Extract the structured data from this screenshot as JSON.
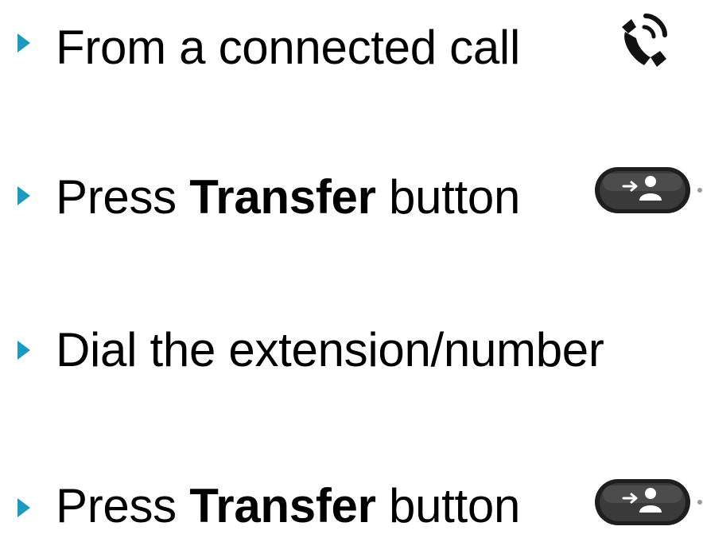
{
  "steps": [
    {
      "text": "From a connected call",
      "icon": "phone-call-icon"
    },
    {
      "text_before": "Press",
      "text_bold": "Transfer",
      "text_after": "button",
      "icon": "transfer-button-icon"
    },
    {
      "text": "Dial the extension/number"
    },
    {
      "text_before": "Press",
      "text_bold": "Transfer",
      "text_after": "button",
      "icon": "transfer-button-icon"
    }
  ],
  "colors": {
    "bullet": "#1c9bc1",
    "text": "#000000",
    "button_dark": "#1e1e1e"
  }
}
